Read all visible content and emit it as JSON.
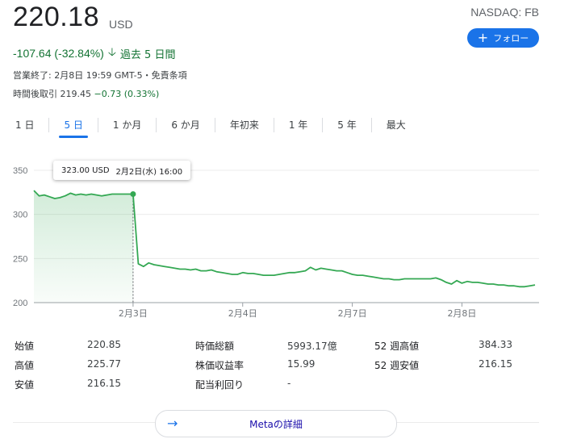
{
  "quote": {
    "price": "220.18",
    "currency": "USD",
    "exchange": "NASDAQ: FB",
    "follow_label": "フォロー",
    "change": "-107.64 (-32.84%)",
    "change_period": "過去 5 日間",
    "market_status": "営業終了: 2月8日 19:59 GMT-5・免責条項",
    "after_hours_label": "時間後取引",
    "after_hours_price": "219.45",
    "after_hours_change": "−0.73 (0.33%)",
    "colors": {
      "positive": "#137333",
      "accent": "#1a73e8",
      "line": "#34a853"
    }
  },
  "tabs": [
    {
      "label": "1 日",
      "active": false
    },
    {
      "label": "5 日",
      "active": true
    },
    {
      "label": "1 か月",
      "active": false
    },
    {
      "label": "6 か月",
      "active": false
    },
    {
      "label": "年初来",
      "active": false
    },
    {
      "label": "1 年",
      "active": false
    },
    {
      "label": "5 年",
      "active": false
    },
    {
      "label": "最大",
      "active": false
    }
  ],
  "tooltip": {
    "price": "323.00 USD",
    "date": "2月2日(水) 16:00"
  },
  "chart_data": {
    "type": "area",
    "y_ticks": [
      350,
      300,
      250,
      200
    ],
    "ylim": [
      200,
      350
    ],
    "x_tick_labels": [
      "2月3日",
      "2月4日",
      "2月7日",
      "2月8日"
    ],
    "x_tick_index": [
      19,
      40,
      61,
      82
    ],
    "grid": true,
    "highlight_index": 19,
    "values": [
      327,
      321,
      322,
      320,
      318,
      319,
      321,
      324,
      322,
      323,
      322,
      323,
      322,
      321,
      322,
      323,
      323,
      323,
      323,
      323,
      244,
      241,
      245,
      243,
      242,
      241,
      240,
      239,
      238,
      238,
      237,
      238,
      236,
      236,
      237,
      235,
      234,
      233,
      232,
      232,
      234,
      233,
      233,
      232,
      231,
      231,
      231,
      232,
      233,
      234,
      234,
      235,
      236,
      240,
      237,
      239,
      238,
      237,
      236,
      236,
      234,
      232,
      231,
      231,
      230,
      229,
      228,
      227,
      227,
      226,
      226,
      227,
      227,
      227,
      227,
      227,
      227,
      228,
      226,
      223,
      221,
      225,
      222,
      224,
      223,
      223,
      222,
      221,
      221,
      220,
      220,
      219,
      219,
      218,
      218,
      219,
      220
    ]
  },
  "stats": [
    {
      "label": "始値",
      "value": "220.85"
    },
    {
      "label": "高値",
      "value": "225.77"
    },
    {
      "label": "安値",
      "value": "216.15"
    },
    {
      "label": "時価総額",
      "value": "5993.17億"
    },
    {
      "label": "株価収益率",
      "value": "15.99"
    },
    {
      "label": "配当利回り",
      "value": "-"
    },
    {
      "label": "52 週高値",
      "value": "384.33"
    },
    {
      "label": "52 週安値",
      "value": "216.15"
    }
  ],
  "details_button": {
    "label": "Metaの詳細"
  },
  "icons": {
    "follow": "plus-icon",
    "change": "down-arrow-icon",
    "details": "right-arrow-icon"
  }
}
